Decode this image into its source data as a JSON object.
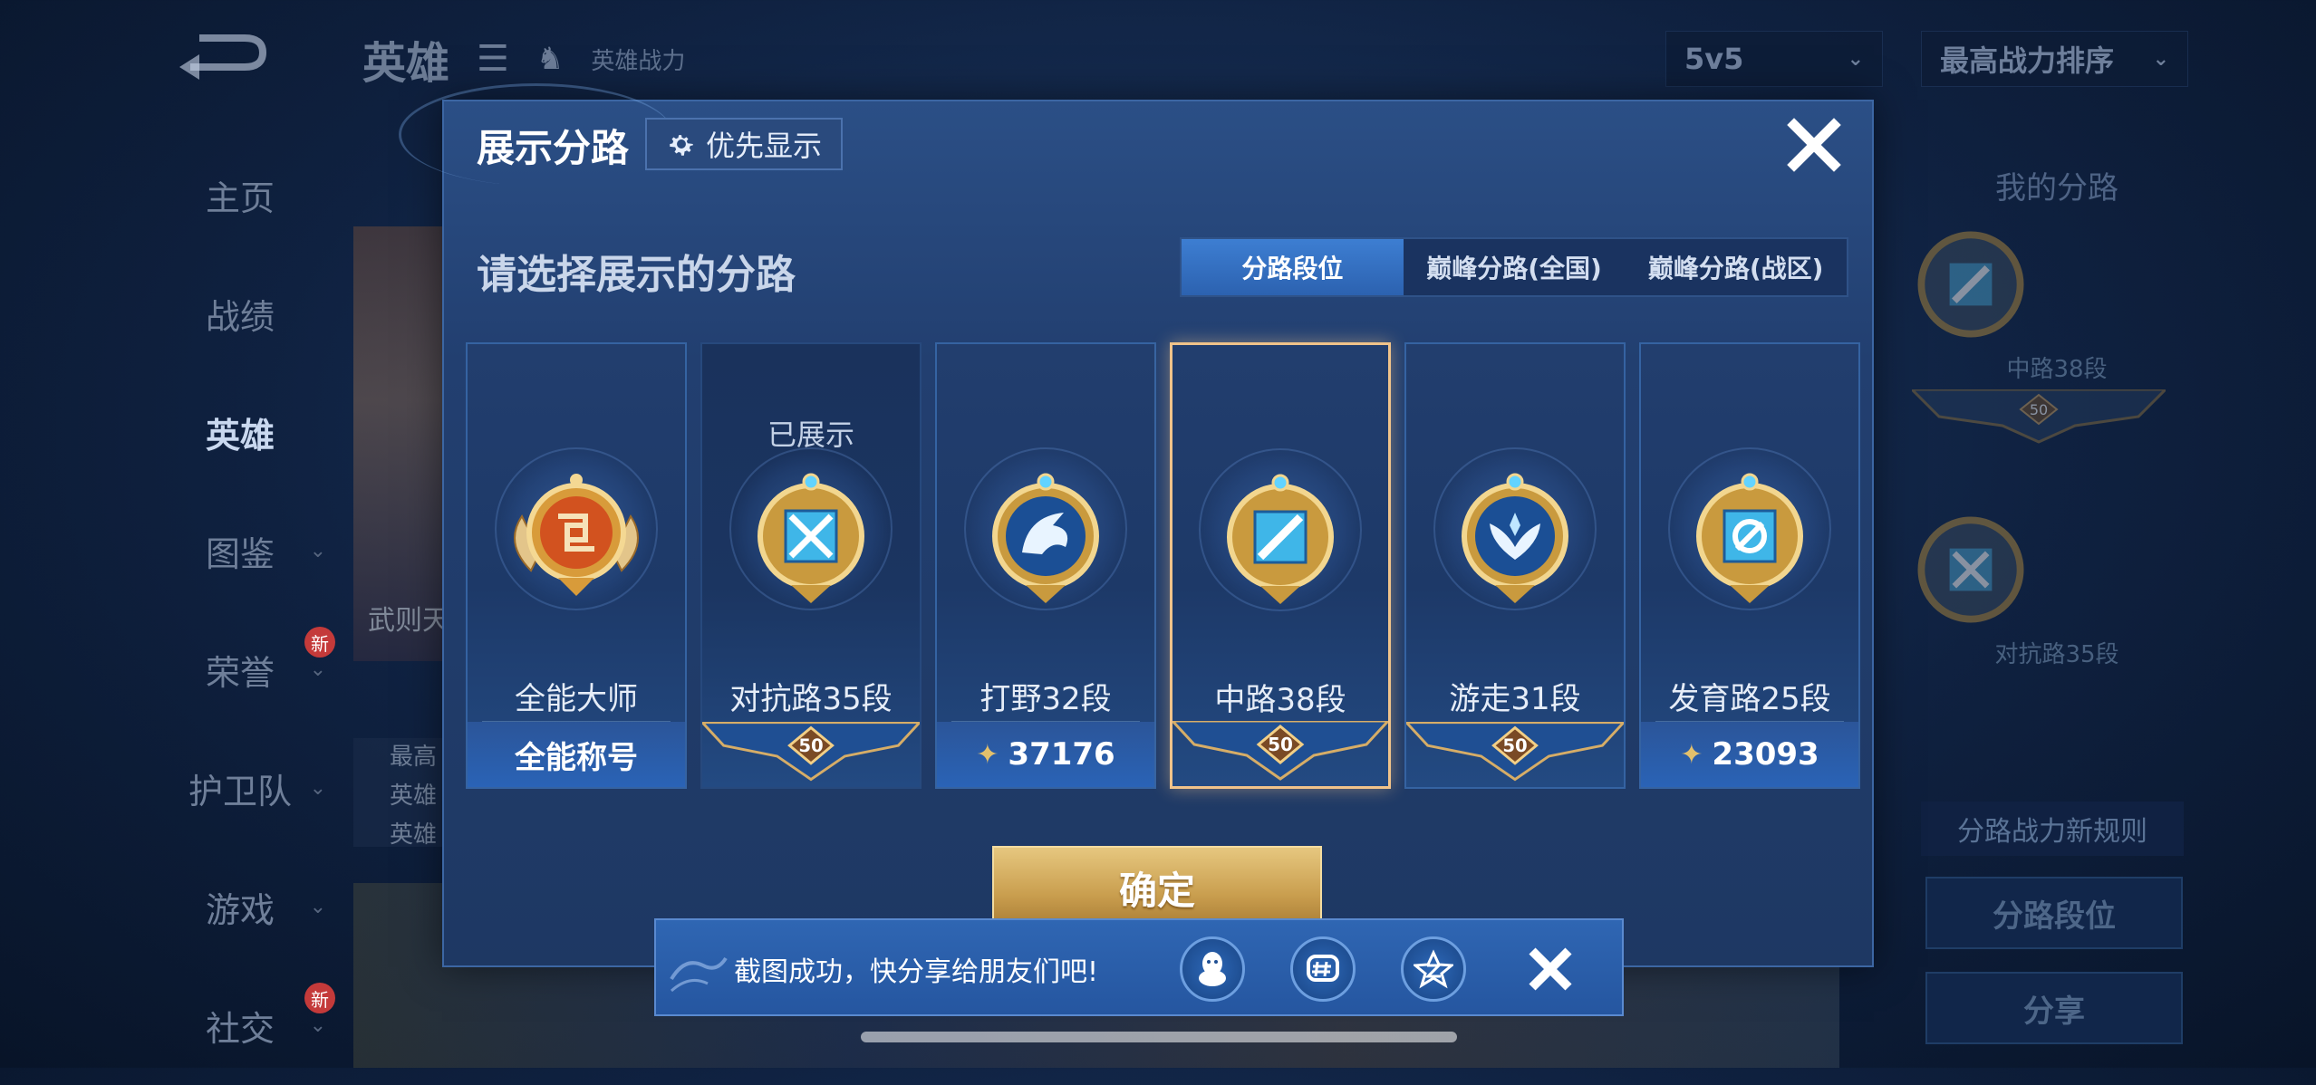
{
  "background": {
    "header": {
      "title": "英雄",
      "subtitle": "英雄战力"
    },
    "dropdowns": {
      "mode": "5v5",
      "sort": "最高战力排序"
    },
    "nav": [
      {
        "label": "主页"
      },
      {
        "label": "战绩"
      },
      {
        "label": "英雄",
        "active": true
      },
      {
        "label": "图鉴"
      },
      {
        "label": "荣誉",
        "badge": "新"
      },
      {
        "label": "护卫队"
      },
      {
        "label": "游戏"
      },
      {
        "label": "社交",
        "badge": "新"
      }
    ],
    "hero_card_name": "武则天",
    "info_lines": [
      "最高",
      "英雄",
      "英雄"
    ],
    "right_panel": {
      "title": "我的分路",
      "lane1_label": "中路38段",
      "lane1_badge": "50",
      "lane2_label": "对抗路35段",
      "rule_text": "分路战力新规则",
      "lane_rank_button": "分路段位",
      "share_button": "分享"
    }
  },
  "modal": {
    "title": "展示分路",
    "priority_button": "优先显示",
    "subtitle": "请选择展示的分路",
    "tabs": [
      {
        "label": "分路段位",
        "active": true
      },
      {
        "label": "巅峰分路(全国)",
        "active": false
      },
      {
        "label": "巅峰分路(战区)",
        "active": false
      }
    ],
    "cards": [
      {
        "name": "全能大师",
        "footer": "全能称号",
        "footer_type": "text",
        "shown_label": "",
        "selected": false,
        "emblem": "all-round-master-icon"
      },
      {
        "name": "对抗路35段",
        "footer": "50",
        "footer_type": "badge",
        "shown_label": "已展示",
        "selected": false,
        "emblem": "clash-lane-icon"
      },
      {
        "name": "打野32段",
        "footer": "37176",
        "footer_type": "power",
        "shown_label": "",
        "selected": false,
        "emblem": "jungle-dragon-icon"
      },
      {
        "name": "中路38段",
        "footer": "50",
        "footer_type": "badge",
        "shown_label": "",
        "selected": true,
        "emblem": "mid-lane-icon"
      },
      {
        "name": "游走31段",
        "footer": "50",
        "footer_type": "badge",
        "shown_label": "",
        "selected": false,
        "emblem": "roam-wings-icon"
      },
      {
        "name": "发育路25段",
        "footer": "23093",
        "footer_type": "power",
        "shown_label": "",
        "selected": false,
        "emblem": "farm-lane-icon"
      }
    ],
    "confirm_button": "确定"
  },
  "toast": {
    "text": "截图成功，快分享给朋友们吧!",
    "share_targets": [
      "qq-icon",
      "wechat-moments-icon",
      "qzone-icon"
    ]
  },
  "colors": {
    "accent_blue": "#3d7ed2",
    "gold": "#d9b060",
    "selected_border": "#f0c38a"
  }
}
